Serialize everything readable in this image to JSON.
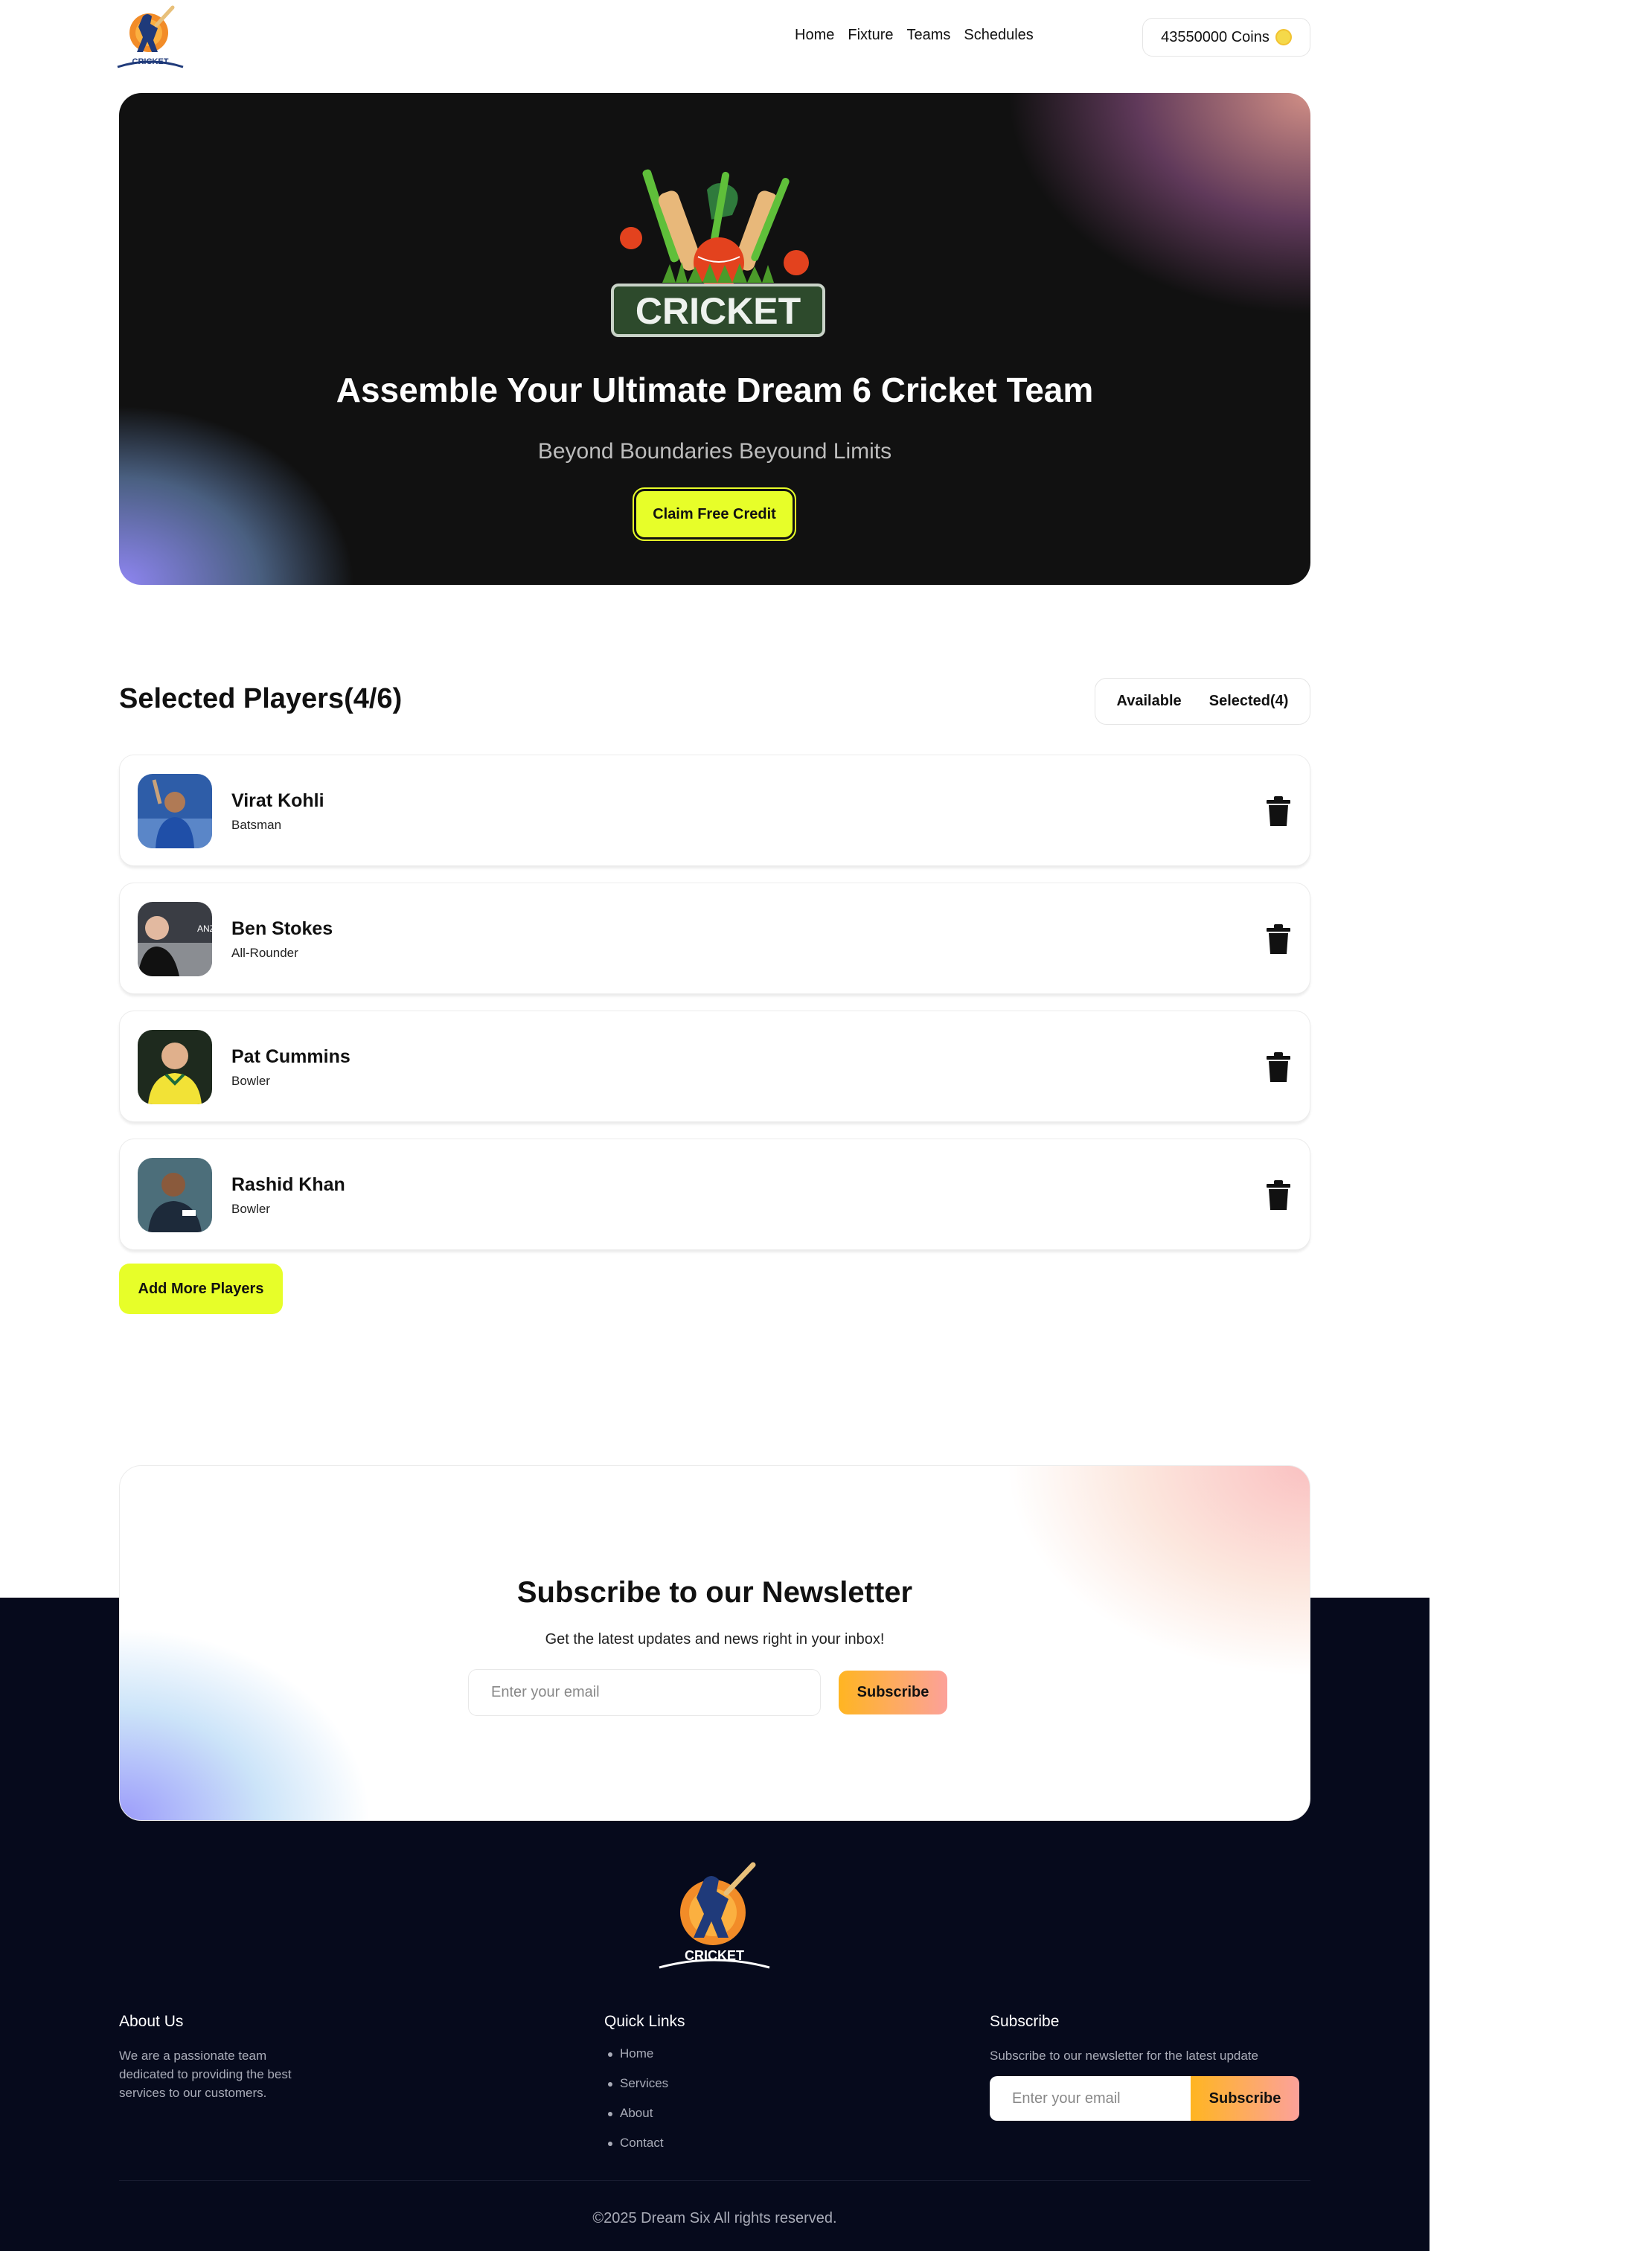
{
  "header": {
    "logo_text": "CRICKET",
    "nav": [
      "Home",
      "Fixture",
      "Teams",
      "Schedules"
    ],
    "coins_label": "43550000 Coins"
  },
  "hero": {
    "logo_text": "CRICKET",
    "title": "Assemble Your Ultimate Dream 6 Cricket Team",
    "subtitle": "Beyond Boundaries Beyound Limits",
    "cta": "Claim Free Credit"
  },
  "selected": {
    "title": "Selected Players(4/6)",
    "toggle": [
      "Available",
      "Selected(4)"
    ],
    "players": [
      {
        "name": "Virat Kohli",
        "role": "Batsman"
      },
      {
        "name": "Ben Stokes",
        "role": "All-Rounder"
      },
      {
        "name": "Pat Cummins",
        "role": "Bowler"
      },
      {
        "name": "Rashid Khan",
        "role": "Bowler"
      }
    ],
    "add_more": "Add More Players"
  },
  "newsletter": {
    "title": "Subscribe to our Newsletter",
    "subtitle": "Get the latest updates and news right in your inbox!",
    "placeholder": "Enter your email",
    "button": "Subscribe"
  },
  "footer": {
    "logo_text": "CRICKET",
    "about_title": "About Us",
    "about_text": "We are a passionate team dedicated to providing the best services to our customers.",
    "links_title": "Quick Links",
    "links": [
      "Home",
      "Services",
      "About",
      "Contact"
    ],
    "subscribe_title": "Subscribe",
    "subscribe_text": "Subscribe to our newsletter for the latest update",
    "placeholder": "Enter your email",
    "button": "Subscribe",
    "copyright": "©2025 Dream Six All rights reserved."
  },
  "colors": {
    "accent": "#e7fe29",
    "footer_bg": "#060a1c",
    "gradient_orange": "#ffb522",
    "gradient_pink": "#fca19a"
  }
}
